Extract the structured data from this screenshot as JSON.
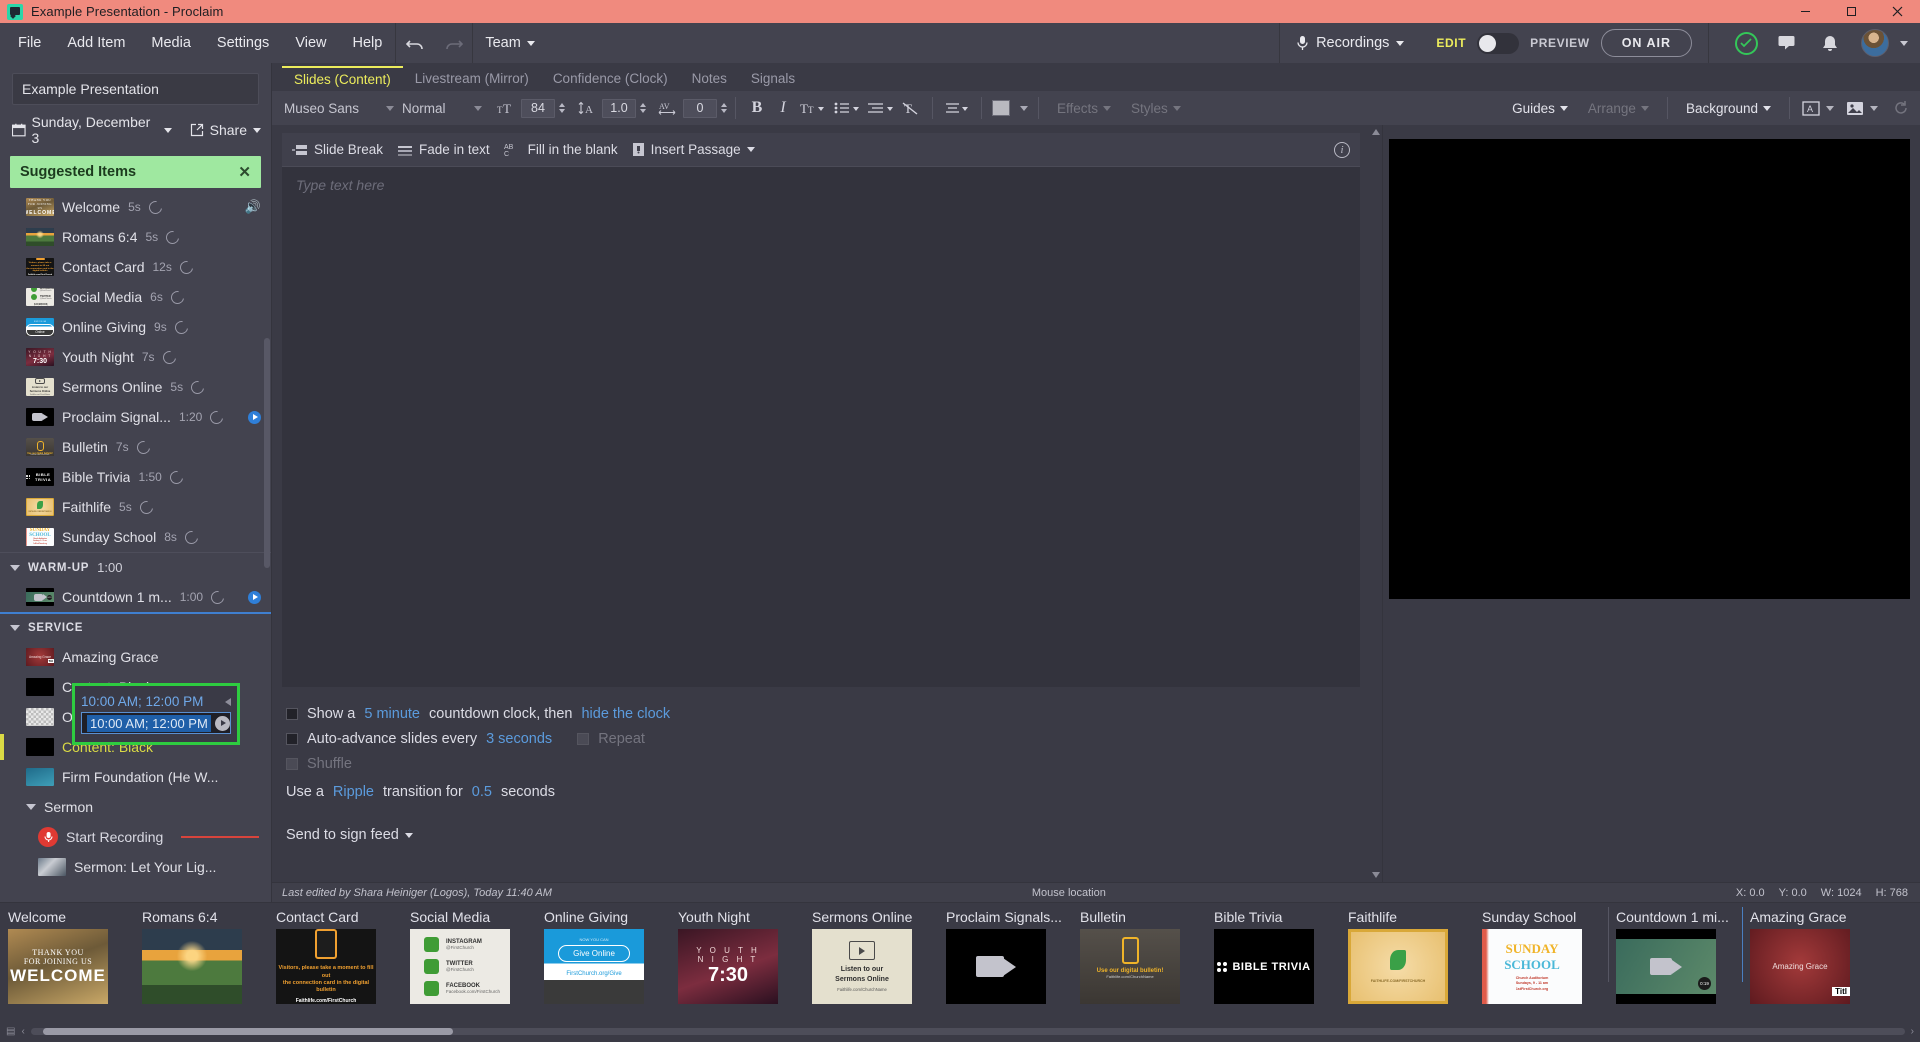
{
  "window": {
    "title": "Example Presentation - Proclaim",
    "logo_icon": "proclaim-logo-icon",
    "minimize_icon": "minimize-icon",
    "maximize_icon": "maximize-icon",
    "close_icon": "close-icon"
  },
  "menubar": {
    "items": [
      "File",
      "Add Item",
      "Media",
      "Settings",
      "View",
      "Help"
    ],
    "undo_icon": "undo-icon",
    "redo_icon": "redo-icon",
    "team_label": "Team",
    "recordings_label": "Recordings",
    "recordings_icon": "microphone-icon",
    "edit_label": "EDIT",
    "preview_label": "PREVIEW",
    "onair_label": "ON AIR",
    "check_icon": "check-circle-icon",
    "chat_icon": "chat-bubble-icon",
    "bell_icon": "notification-bell-icon",
    "avatar_icon": "user-avatar"
  },
  "sidebar": {
    "presentation_name": "Example Presentation",
    "date_label": "Sunday, December 3",
    "share_label": "Share",
    "calendar_icon": "calendar-icon",
    "share_icon": "share-external-icon",
    "suggested_label": "Suggested Items",
    "suggested_close_icon": "close-icon",
    "suggested_items": [
      {
        "label": "Welcome",
        "duration": "5s",
        "loop": true,
        "thumb": "welcome",
        "speaker": true
      },
      {
        "label": "Romans 6:4",
        "duration": "5s",
        "loop": true,
        "thumb": "romans"
      },
      {
        "label": "Contact Card",
        "duration": "12s",
        "loop": true,
        "thumb": "contact"
      },
      {
        "label": "Social Media",
        "duration": "6s",
        "loop": true,
        "thumb": "social"
      },
      {
        "label": "Online Giving",
        "duration": "9s",
        "loop": true,
        "thumb": "giving"
      },
      {
        "label": "Youth Night",
        "duration": "7s",
        "loop": true,
        "thumb": "youth"
      },
      {
        "label": "Sermons Online",
        "duration": "5s",
        "loop": true,
        "thumb": "sermons"
      },
      {
        "label": "Proclaim Signal...",
        "duration": "1:20",
        "loop": true,
        "thumb": "video",
        "play": true
      },
      {
        "label": "Bulletin",
        "duration": "7s",
        "loop": true,
        "thumb": "bulletin"
      },
      {
        "label": "Bible Trivia",
        "duration": "1:50",
        "loop": true,
        "thumb": "trivia"
      },
      {
        "label": "Faithlife",
        "duration": "5s",
        "loop": true,
        "thumb": "faithlife"
      },
      {
        "label": "Sunday School",
        "duration": "8s",
        "loop": true,
        "thumb": "school"
      }
    ],
    "warmup_group": {
      "label": "WARM-UP",
      "duration": "1:00"
    },
    "warmup_items": [
      {
        "label": "Countdown 1 m...",
        "duration": "1:00",
        "loop": true,
        "thumb": "countdown",
        "play": true
      }
    ],
    "service_group": {
      "label": "SERVICE"
    },
    "service_items": [
      {
        "label": "Amazing Grace",
        "thumb": "amazing"
      },
      {
        "label": "Content: Black",
        "thumb": "black"
      },
      {
        "label": "On-Screen Bible",
        "thumb": "checker"
      },
      {
        "label": "Content: Black",
        "thumb": "black",
        "selected": true
      },
      {
        "label": "Firm Foundation (He W... ",
        "thumb": "firm"
      }
    ],
    "sermon_group": {
      "label": "Sermon"
    },
    "sermon_items": [
      {
        "label": "Start Recording",
        "icon": "record-microphone-icon"
      },
      {
        "label": "Sermon: Let Your Lig...",
        "thumb": "sermon"
      }
    ],
    "time_editor": {
      "display_value": "10:00 AM; 12:00 PM",
      "input_value": "10:00 AM; 12:00 PM",
      "go_icon": "go-arrow-icon",
      "collapse_icon": "collapse-arrow-icon",
      "highlight_color": "#2ecc40"
    }
  },
  "tabs": [
    {
      "label": "Slides (Content)",
      "active": true
    },
    {
      "label": "Livestream (Mirror)",
      "active": false
    },
    {
      "label": "Confidence (Clock)",
      "active": false
    },
    {
      "label": "Notes",
      "active": false
    },
    {
      "label": "Signals",
      "active": false
    }
  ],
  "format_toolbar": {
    "font_family": "Museo Sans",
    "font_style": "Normal",
    "font_size": "84",
    "line_height": "1.0",
    "letter_spacing": "0",
    "font_size_icon": "font-size-icon",
    "line_height_icon": "line-height-icon",
    "letter_spacing_icon": "letter-spacing-icon",
    "bold_label": "B",
    "italic_label": "I",
    "text_case_icon": "text-case-icon",
    "bullet_list_icon": "bullet-list-icon",
    "indent_icon": "indent-icon",
    "clear_format_icon": "clear-formatting-icon",
    "align_icon": "align-icon",
    "color_icon": "text-color-icon",
    "effects_label": "Effects",
    "styles_label": "Styles",
    "guides_label": "Guides",
    "arrange_label": "Arrange",
    "background_label": "Background",
    "text_box_icon": "text-box-icon",
    "image_box_icon": "image-box-icon",
    "reset_icon": "reset-icon"
  },
  "editor": {
    "toolbar": [
      {
        "label": "Slide Break",
        "icon": "slide-break-icon"
      },
      {
        "label": "Fade in text",
        "icon": "fade-in-text-icon"
      },
      {
        "label": "Fill in the blank",
        "icon": "fill-in-blank-icon"
      },
      {
        "label": "Insert Passage",
        "icon": "insert-passage-icon",
        "caret": true
      }
    ],
    "info_icon": "info-icon",
    "placeholder": "Type text here",
    "options": {
      "countdown_pre": "Show a",
      "countdown_minutes": "5 minute",
      "countdown_mid": "countdown clock, then",
      "countdown_link": "hide the clock",
      "autoadvance_pre": "Auto-advance slides every",
      "autoadvance_value": "3 seconds",
      "repeat_label": "Repeat",
      "shuffle_label": "Shuffle",
      "transition_pre": "Use a",
      "transition_name": "Ripple",
      "transition_mid": "transition for",
      "transition_seconds": "0.5",
      "transition_post": "seconds",
      "sign_feed_label": "Send to sign feed"
    }
  },
  "statusbar": {
    "last_edited": "Last edited by Shara Heiniger (Logos), Today 11:40 AM",
    "mouse_location_label": "Mouse location",
    "x": "X: 0.0",
    "y": "Y: 0.0",
    "w": "W: 1024",
    "h": "H: 768"
  },
  "filmstrip": {
    "slides": [
      {
        "title": "Welcome",
        "thumb": "welcome"
      },
      {
        "title": "Romans 6:4",
        "thumb": "romans"
      },
      {
        "title": "Contact Card",
        "thumb": "contact"
      },
      {
        "title": "Social Media",
        "thumb": "social"
      },
      {
        "title": "Online Giving",
        "thumb": "giving"
      },
      {
        "title": "Youth Night",
        "thumb": "youth"
      },
      {
        "title": "Sermons Online",
        "thumb": "sermons"
      },
      {
        "title": "Proclaim Signals...",
        "thumb": "video"
      },
      {
        "title": "Bulletin",
        "thumb": "bulletin"
      },
      {
        "title": "Bible Trivia",
        "thumb": "trivia"
      },
      {
        "title": "Faithlife",
        "thumb": "faithlife"
      },
      {
        "title": "Sunday School",
        "thumb": "school"
      },
      {
        "title": "Countdown 1 mi...",
        "thumb": "countdown",
        "divider": true
      },
      {
        "title": "Amazing Grace",
        "thumb": "amazing",
        "divider": true,
        "divider_blue": true
      }
    ],
    "thumb_text": {
      "welcome_l1": "THANK YOU",
      "welcome_l2": "FOR JOINING US",
      "welcome_l3": "WELCOME",
      "contact_l1": "Visitors, please take a moment to fill out",
      "contact_l2": "the connection card in the digital bulletin",
      "contact_l3": "Faithlife.com/FirstChurch",
      "social_1": "INSTAGRAM",
      "social_1s": "@FirstChurch",
      "social_2": "TWITTER",
      "social_2s": "@FirstChurch",
      "social_3": "FACEBOOK",
      "social_3s": "Facebook.com/FirstChurch",
      "giving_top": "NOW YOU CAN",
      "giving_btn": "Give Online",
      "giving_url": "FirstChurch.org/Give",
      "youth_1": "Y O U T H",
      "youth_2": "N I G H T",
      "youth_3": "7:30",
      "sermons_1": "Listen to our",
      "sermons_2": "Sermons Online",
      "sermons_3": "Faithlife.com/ChurchName",
      "bulletin_1": "Use our digital bulletin!",
      "bulletin_2": "Faithlife.com/ChurchName",
      "trivia_1": "BIBLE TRIVIA",
      "faithlife_1": "FAITHLIFE.COM/FIRSTCHURCH",
      "school_1": "SUNDAY",
      "school_2": "SCHOOL",
      "school_3": "Church Auditorium",
      "school_4": "Sundays, 9 - 11 am",
      "school_5": "1stFirstChurch.org",
      "countdown_time": "0:19",
      "amazing_1": "Amazing Grace",
      "amazing_tag": "Titl"
    }
  }
}
